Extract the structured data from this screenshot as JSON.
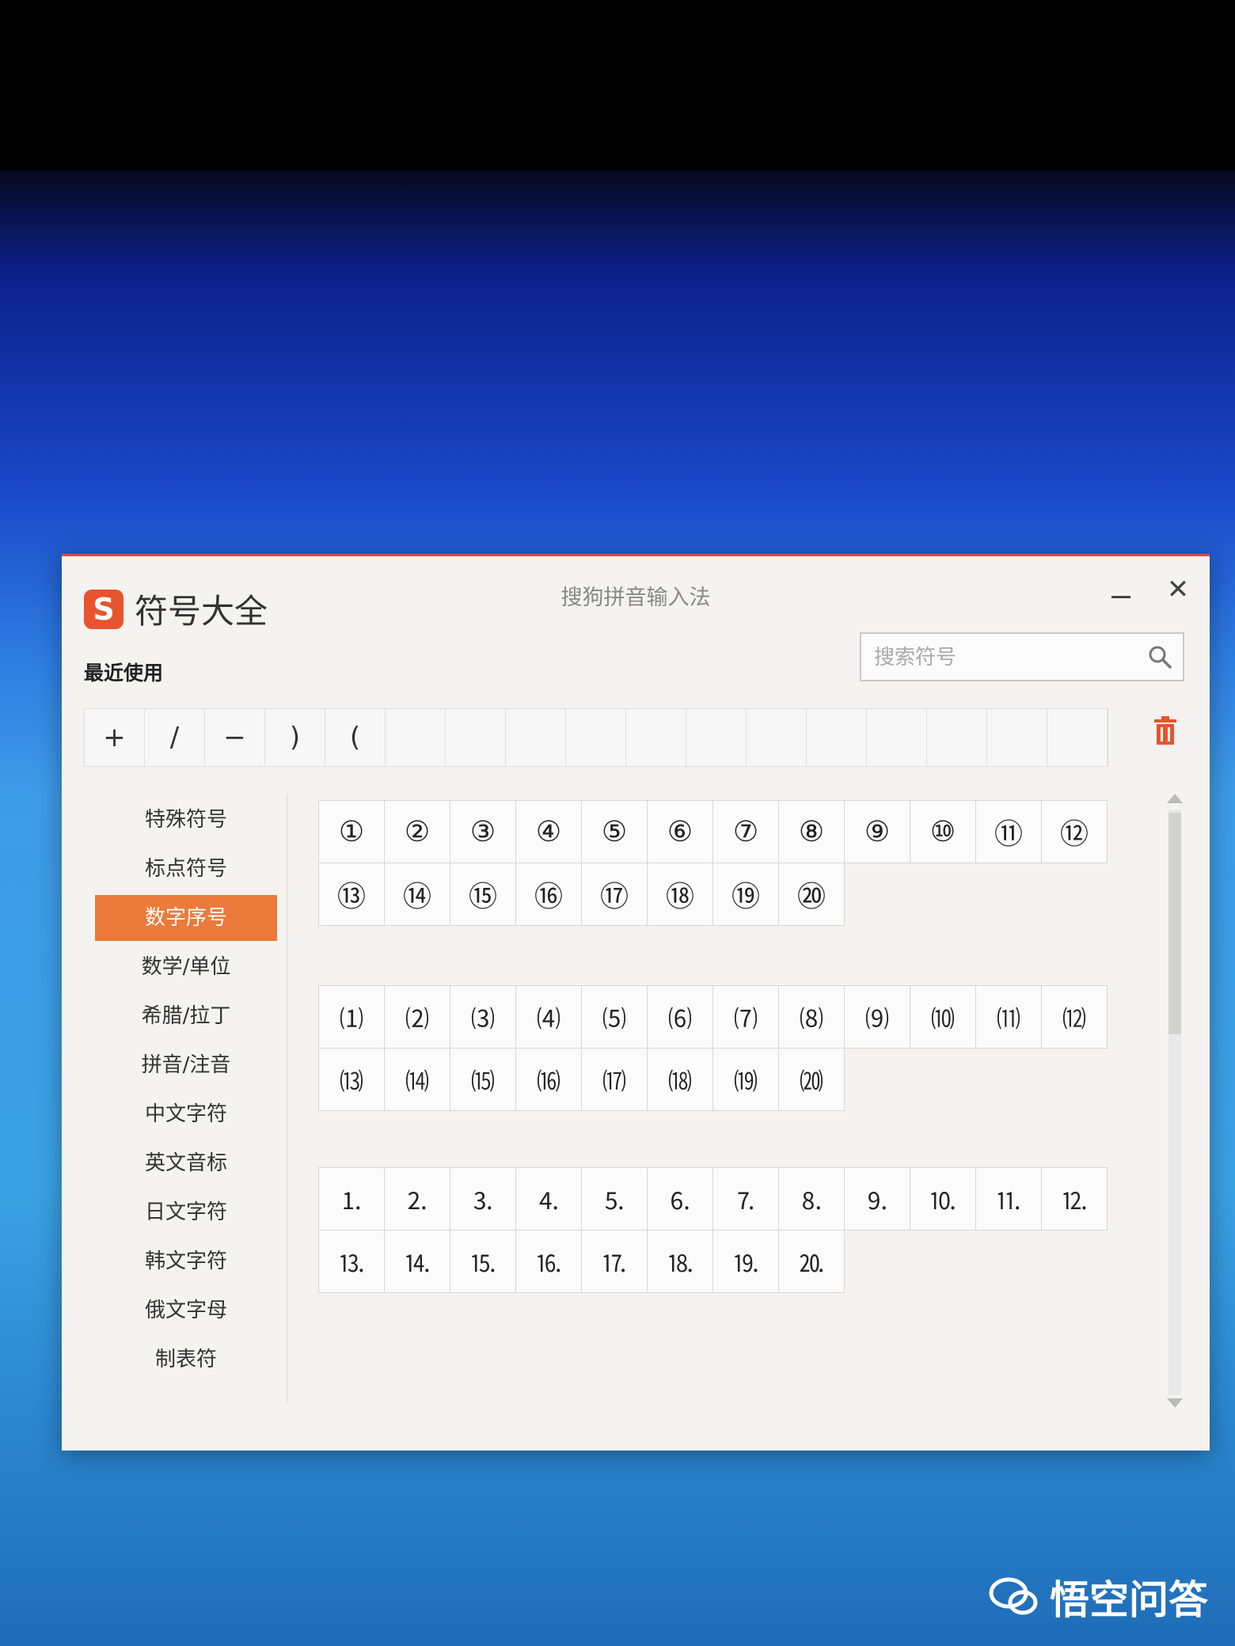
{
  "window": {
    "app_title": "符号大全",
    "logo_letter": "S",
    "title": "搜狗拼音输入法",
    "close_glyph": "✕"
  },
  "recent": {
    "label": "最近使用",
    "items": [
      "+",
      "/",
      "−",
      ")",
      "(",
      "",
      "",
      "",
      "",
      "",
      "",
      "",
      "",
      "",
      "",
      "",
      ""
    ]
  },
  "search": {
    "placeholder": "搜索符号"
  },
  "categories": [
    {
      "label": "特殊符号"
    },
    {
      "label": "标点符号"
    },
    {
      "label": "数字序号",
      "active": true
    },
    {
      "label": "数学/单位"
    },
    {
      "label": "希腊/拉丁"
    },
    {
      "label": "拼音/注音"
    },
    {
      "label": "中文字符"
    },
    {
      "label": "英文音标"
    },
    {
      "label": "日文字符"
    },
    {
      "label": "韩文字符"
    },
    {
      "label": "俄文字母"
    },
    {
      "label": "制表符"
    }
  ],
  "symbol_groups": [
    {
      "rows": [
        [
          "①",
          "②",
          "③",
          "④",
          "⑤",
          "⑥",
          "⑦",
          "⑧",
          "⑨",
          "⑩",
          "⑪",
          "⑫"
        ],
        [
          "⑬",
          "⑭",
          "⑮",
          "⑯",
          "⑰",
          "⑱",
          "⑲",
          "⑳"
        ]
      ]
    },
    {
      "rows": [
        [
          "⑴",
          "⑵",
          "⑶",
          "⑷",
          "⑸",
          "⑹",
          "⑺",
          "⑻",
          "⑼",
          "⑽",
          "⑾",
          "⑿"
        ],
        [
          "⒀",
          "⒁",
          "⒂",
          "⒃",
          "⒄",
          "⒅",
          "⒆",
          "⒇"
        ]
      ]
    },
    {
      "rows": [
        [
          "⒈",
          "⒉",
          "⒊",
          "⒋",
          "⒌",
          "⒍",
          "⒎",
          "⒏",
          "⒐",
          "⒑",
          "⒒",
          "⒓"
        ],
        [
          "⒔",
          "⒕",
          "⒖",
          "⒗",
          "⒘",
          "⒙",
          "⒚",
          "⒛"
        ]
      ]
    }
  ],
  "watermark": {
    "text": "悟空问答"
  },
  "colors": {
    "accent": "#ec7a3a",
    "logo": "#e8542e",
    "border_top": "#e24a3a"
  }
}
